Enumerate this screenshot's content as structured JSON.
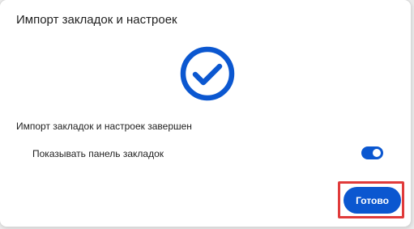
{
  "dialog": {
    "title": "Импорт закладок и настроек",
    "status_icon": "checkmark-circle-icon",
    "message": "Импорт закладок и настроек завершен",
    "toggle": {
      "label": "Показывать панель закладок",
      "checked": true
    },
    "done_label": "Готово"
  },
  "colors": {
    "accent": "#0b57d0",
    "highlight": "#e03a3a"
  }
}
